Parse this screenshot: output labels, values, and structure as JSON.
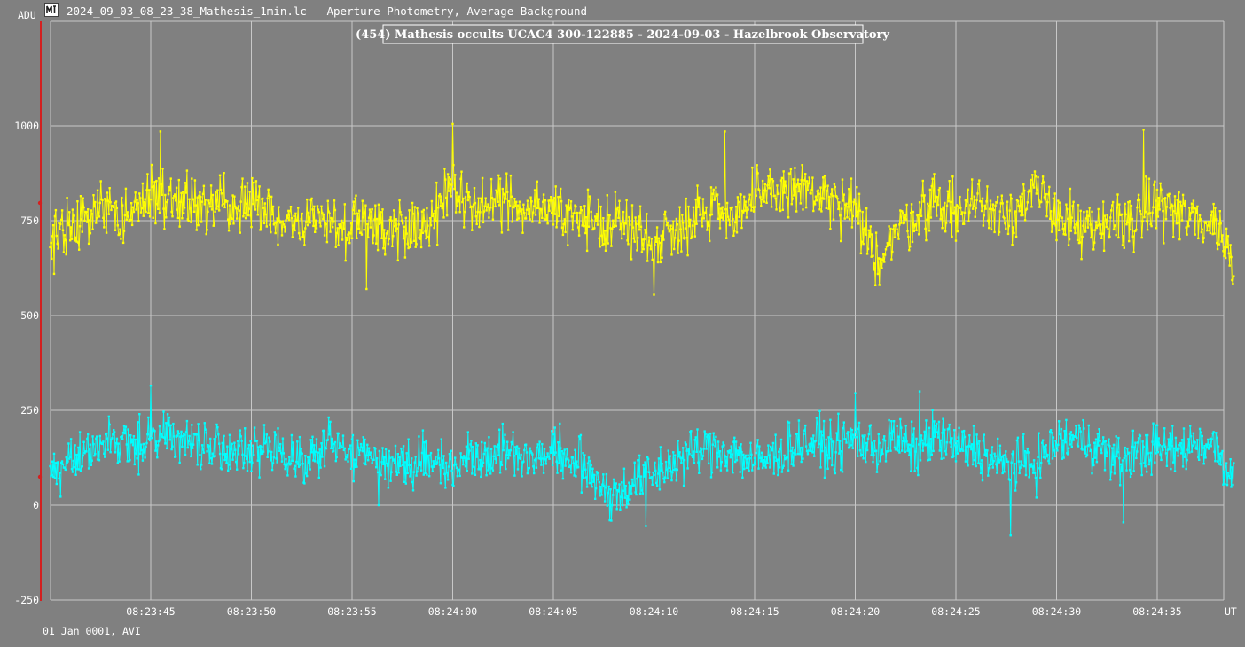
{
  "window": {
    "title": "2024_09_03_08_23_38_Mathesis_1min.lc - Aperture Photometry, Average Background",
    "icon": "tangra-app-icon"
  },
  "footer": {
    "date_label": "01 Jan 0001, AVI"
  },
  "colors": {
    "background": "#808080",
    "grid": "#c8c8c8",
    "target_series": "#ffff00",
    "comparison_series": "#00ffff",
    "marker_line": "#d42020"
  },
  "chart_data": {
    "type": "line",
    "title": "(454) Mathesis occults UCAC4 300-122885 - 2024-09-03 - Hazelbrook Observatory",
    "ylabel": "ADU",
    "xlabel": "UT",
    "ylim": [
      -250,
      1250
    ],
    "yticks": [
      -250,
      0,
      250,
      500,
      750,
      1000
    ],
    "x_unit": "seconds after 08:23:40",
    "xlim": [
      0,
      58.8
    ],
    "xticks": [
      {
        "x": 5,
        "label": "08:23:45"
      },
      {
        "x": 10,
        "label": "08:23:50"
      },
      {
        "x": 15,
        "label": "08:23:55"
      },
      {
        "x": 20,
        "label": "08:24:00"
      },
      {
        "x": 25,
        "label": "08:24:05"
      },
      {
        "x": 30,
        "label": "08:24:10"
      },
      {
        "x": 35,
        "label": "08:24:15"
      },
      {
        "x": 40,
        "label": "08:24:20"
      },
      {
        "x": 45,
        "label": "08:24:25"
      },
      {
        "x": 50,
        "label": "08:24:30"
      },
      {
        "x": 55,
        "label": "08:24:35"
      }
    ],
    "grid": true,
    "sample_interval_s": 0.04,
    "series": [
      {
        "id": "target",
        "color": "#ffff00",
        "profile": [
          [
            0,
            725
          ],
          [
            1.5,
            735
          ],
          [
            2.5,
            800
          ],
          [
            3.5,
            755
          ],
          [
            5,
            820
          ],
          [
            6,
            815
          ],
          [
            7.5,
            790
          ],
          [
            9,
            775
          ],
          [
            10,
            800
          ],
          [
            11,
            755
          ],
          [
            12,
            735
          ],
          [
            13,
            755
          ],
          [
            14,
            745
          ],
          [
            15.5,
            745
          ],
          [
            16.5,
            730
          ],
          [
            18,
            740
          ],
          [
            19,
            745
          ],
          [
            20,
            830
          ],
          [
            21,
            780
          ],
          [
            22,
            800
          ],
          [
            23,
            790
          ],
          [
            24,
            800
          ],
          [
            25,
            780
          ],
          [
            26,
            755
          ],
          [
            27,
            740
          ],
          [
            28,
            755
          ],
          [
            29,
            720
          ],
          [
            30,
            700
          ],
          [
            31,
            730
          ],
          [
            32,
            760
          ],
          [
            33,
            790
          ],
          [
            34,
            770
          ],
          [
            35,
            800
          ],
          [
            36,
            825
          ],
          [
            37,
            840
          ],
          [
            38,
            820
          ],
          [
            39,
            790
          ],
          [
            40,
            770
          ],
          [
            41,
            645
          ],
          [
            42,
            720
          ],
          [
            43,
            765
          ],
          [
            44,
            805
          ],
          [
            45,
            770
          ],
          [
            46,
            800
          ],
          [
            47,
            780
          ],
          [
            48,
            780
          ],
          [
            49,
            820
          ],
          [
            50,
            775
          ],
          [
            51,
            730
          ],
          [
            52,
            715
          ],
          [
            53,
            760
          ],
          [
            54,
            745
          ],
          [
            55,
            800
          ],
          [
            56,
            770
          ],
          [
            57,
            750
          ],
          [
            58,
            740
          ],
          [
            58.8,
            630
          ]
        ],
        "noise_amplitude": 55,
        "peak_points": [
          [
            20.0,
            1005
          ],
          [
            5.5,
            985
          ],
          [
            54.3,
            990
          ],
          [
            33.5,
            985
          ],
          [
            15.7,
            570
          ],
          [
            30.0,
            555
          ],
          [
            41.0,
            580
          ],
          [
            0.2,
            610
          ]
        ]
      },
      {
        "id": "comparison",
        "color": "#00ffff",
        "profile": [
          [
            0,
            75
          ],
          [
            1,
            110
          ],
          [
            2,
            160
          ],
          [
            3,
            165
          ],
          [
            4,
            150
          ],
          [
            5,
            185
          ],
          [
            6,
            185
          ],
          [
            7,
            170
          ],
          [
            8,
            145
          ],
          [
            9,
            150
          ],
          [
            10,
            130
          ],
          [
            11,
            150
          ],
          [
            12,
            125
          ],
          [
            13,
            130
          ],
          [
            14,
            160
          ],
          [
            15,
            140
          ],
          [
            16,
            125
          ],
          [
            17,
            120
          ],
          [
            18,
            110
          ],
          [
            19,
            115
          ],
          [
            20,
            105
          ],
          [
            21,
            135
          ],
          [
            22,
            140
          ],
          [
            23,
            140
          ],
          [
            24,
            125
          ],
          [
            25,
            140
          ],
          [
            26,
            115
          ],
          [
            27,
            80
          ],
          [
            28,
            25
          ],
          [
            29,
            60
          ],
          [
            30,
            80
          ],
          [
            31,
            115
          ],
          [
            32,
            140
          ],
          [
            33,
            150
          ],
          [
            34,
            140
          ],
          [
            35,
            110
          ],
          [
            36,
            130
          ],
          [
            37,
            160
          ],
          [
            38,
            165
          ],
          [
            39,
            150
          ],
          [
            40,
            175
          ],
          [
            41,
            150
          ],
          [
            42,
            175
          ],
          [
            43,
            140
          ],
          [
            44,
            185
          ],
          [
            45,
            150
          ],
          [
            46,
            150
          ],
          [
            47,
            110
          ],
          [
            48,
            110
          ],
          [
            49,
            110
          ],
          [
            50,
            165
          ],
          [
            51,
            175
          ],
          [
            52,
            160
          ],
          [
            53,
            115
          ],
          [
            54,
            140
          ],
          [
            55,
            150
          ],
          [
            56,
            140
          ],
          [
            57,
            170
          ],
          [
            58,
            150
          ],
          [
            58.8,
            60
          ]
        ],
        "noise_amplitude": 48,
        "peak_points": [
          [
            5.0,
            315
          ],
          [
            40.0,
            295
          ],
          [
            43.2,
            300
          ],
          [
            27.8,
            -40
          ],
          [
            29.6,
            -55
          ],
          [
            47.7,
            -80
          ],
          [
            53.3,
            -45
          ],
          [
            16.3,
            0
          ]
        ]
      }
    ]
  }
}
